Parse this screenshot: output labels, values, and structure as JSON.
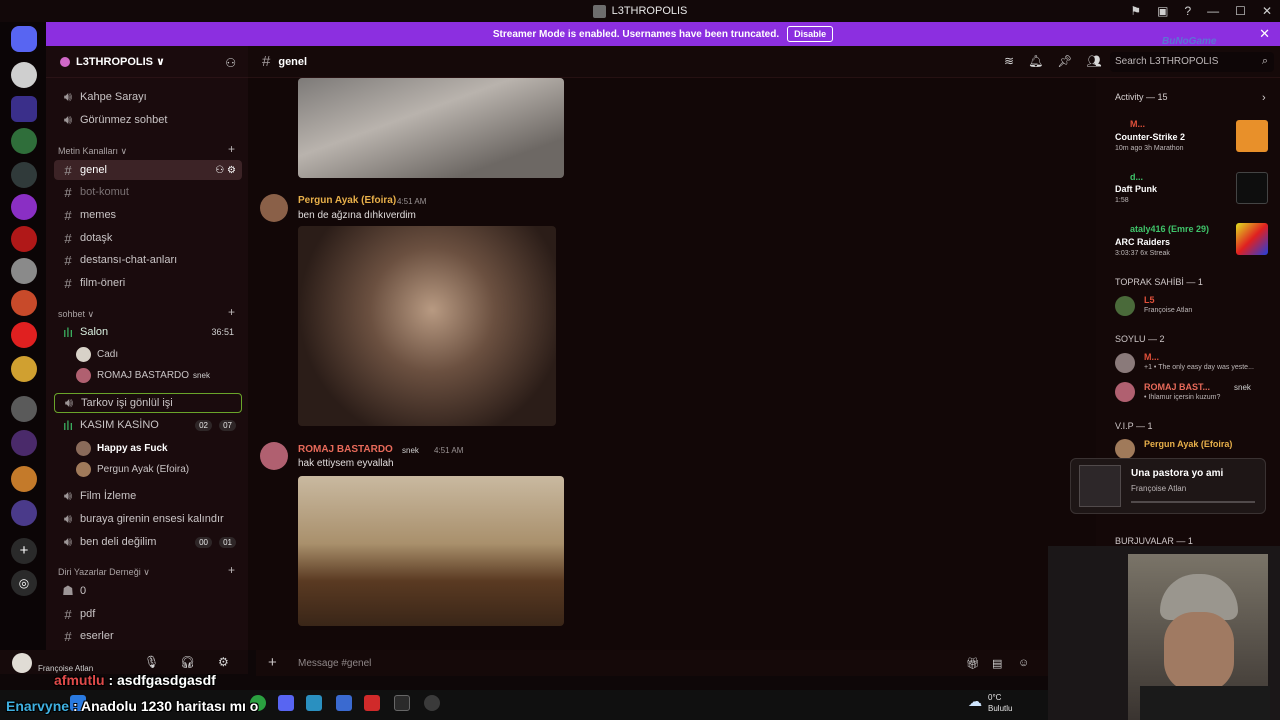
{
  "window": {
    "title": "L3THROPOLIS"
  },
  "banner": {
    "text": "Streamer Mode is enabled. Usernames have been truncated.",
    "disable_label": "Disable"
  },
  "server": {
    "name": "L3THROPOLIS ∨"
  },
  "sidebar": {
    "top_channels": [
      {
        "label": "Kahpe Sarayı"
      },
      {
        "label": "Görünmez sohbet"
      }
    ],
    "text_category": "Metin Kanalları ∨",
    "text_channels": [
      {
        "label": "genel"
      },
      {
        "label": "bot-komut"
      },
      {
        "label": "memes"
      },
      {
        "label": "dotaşk"
      },
      {
        "label": "destansı-chat-anları"
      },
      {
        "label": "film-öneri"
      }
    ],
    "voice_category": "sohbet ∨",
    "salon": {
      "label": "Salon",
      "time": "36:51"
    },
    "salon_users": [
      {
        "name": "Cadı"
      },
      {
        "name": "ROMAJ BASTARDO",
        "tag": "snek"
      }
    ],
    "tarkov": {
      "label": "Tarkov işi gönlül işi"
    },
    "kasim": {
      "label": "KASIM KASİNO",
      "count_a": "02",
      "count_b": "07"
    },
    "kasim_users": [
      {
        "name": "Happy as Fuck"
      },
      {
        "name": "Pergun Ayak (Efoira)"
      }
    ],
    "more_voice": [
      {
        "label": "Film İzleme"
      },
      {
        "label": "buraya girenin ensesi kalındır"
      },
      {
        "label": "ben deli değilim",
        "count_a": "00",
        "count_b": "01"
      }
    ],
    "bottom_category": "Diri Yazarlar Derneği ∨",
    "bottom_channels": [
      {
        "label": "0"
      },
      {
        "label": "pdf"
      },
      {
        "label": "eserler"
      }
    ]
  },
  "user_panel": {
    "name": "Françoise Atlan"
  },
  "header": {
    "channel": "genel",
    "search_placeholder": "Search L3THROPOLIS"
  },
  "watermark": "BuNoGame",
  "messages": [
    {
      "author": "Pergun Ayak (Efoira)",
      "time": "4:51 AM",
      "text": "ben de ağzına dıhkıverdim",
      "author_color": "#e8b04a"
    },
    {
      "author": "ROMAJ BASTARDO",
      "tag": "snek",
      "time": "4:51 AM",
      "text": "hak ettiysem eyvallah",
      "author_color": "#e86a5a"
    }
  ],
  "composer": {
    "placeholder": "Message #genel"
  },
  "members": {
    "activity_header": "Activity — 15",
    "activities": [
      {
        "name": "M...",
        "game": "Counter-Strike 2",
        "detail": "10m ago   3h Marathon",
        "name_color": "#e0503a"
      },
      {
        "name": "d...",
        "game": "Daft Punk",
        "detail": "1:58",
        "name_color": "#3fc46a"
      },
      {
        "name": "ataly416 (Emre 29)",
        "game": "ARC Raiders",
        "detail": "3:03:37   6x Streak",
        "name_color": "#3fc46a"
      }
    ],
    "group1": "TOPRAK SAHİBİ — 1",
    "group1_users": [
      {
        "name": "L5",
        "sub": "Françoise Atlan",
        "color": "#e0503a"
      }
    ],
    "group2": "SOYLU — 2",
    "group2_users": [
      {
        "name": "M...",
        "sub": "+1 • The only easy day was yeste...",
        "color": "#e0503a"
      },
      {
        "name": "ROMAJ BAST...",
        "tag": "snek",
        "sub": "• Ihlamur içersin kuzum?",
        "color": "#e86a5a"
      }
    ],
    "group3": "V.I.P — 1",
    "group3_users": [
      {
        "name": "Pergun Ayak (Efoira)",
        "color": "#e8b04a"
      }
    ],
    "group4": "BURJUVALAR — 1"
  },
  "now_playing": {
    "title": "Una pastora yo ami",
    "artist": "Françoise Atlan"
  },
  "overlay_chat": [
    {
      "user": "afmutlu",
      "text": ": asdfgasdgasdf"
    },
    {
      "user": "Enarvyne",
      "text": ": Anadolu 1230 haritası mı o"
    }
  ],
  "weather": {
    "temp": "0°C",
    "desc": "Bulutlu"
  }
}
